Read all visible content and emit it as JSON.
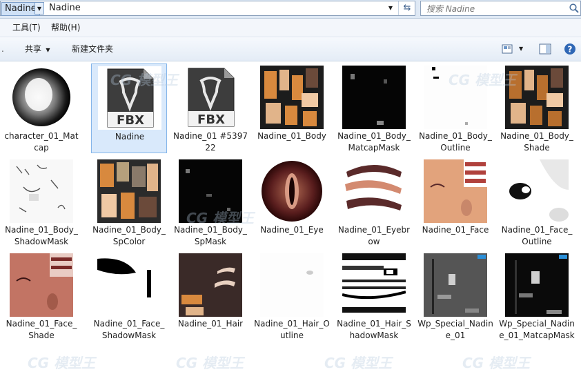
{
  "address_bar": {
    "crumbs": [
      "Nadine",
      "Nadine"
    ],
    "search_placeholder": "搜索 Nadine"
  },
  "menu": {
    "items": [
      "工具(T)",
      "帮助(H)"
    ]
  },
  "toolbar": {
    "share_label": "共享",
    "new_folder_label": "新建文件夹"
  },
  "files": [
    {
      "name": "character_01_Matcap",
      "kind": "matcap",
      "selected": false
    },
    {
      "name": "Nadine",
      "kind": "fbx",
      "selected": true
    },
    {
      "name": "Nadine_01 #539722",
      "kind": "fbx",
      "selected": false
    },
    {
      "name": "Nadine_01_Body",
      "kind": "body",
      "selected": false
    },
    {
      "name": "Nadine_01_Body_MatcapMask",
      "kind": "dark-mask",
      "selected": false
    },
    {
      "name": "Nadine_01_Body_Outline",
      "kind": "white-dots",
      "selected": false
    },
    {
      "name": "Nadine_01_Body_Shade",
      "kind": "body-dark",
      "selected": false
    },
    {
      "name": "Nadine_01_Body_ShadowMask",
      "kind": "white-sketch",
      "selected": false
    },
    {
      "name": "Nadine_01_Body_SpColor",
      "kind": "spcolor",
      "selected": false
    },
    {
      "name": "Nadine_01_Body_SpMask",
      "kind": "dark-spots",
      "selected": false
    },
    {
      "name": "Nadine_01_Eye",
      "kind": "eye",
      "selected": false
    },
    {
      "name": "Nadine_01_Eyebrow",
      "kind": "eyebrow",
      "selected": false
    },
    {
      "name": "Nadine_01_Face",
      "kind": "face",
      "selected": false
    },
    {
      "name": "Nadine_01_Face_Outline",
      "kind": "face-outline",
      "selected": false
    },
    {
      "name": "Nadine_01_Face_Shade",
      "kind": "face-shade",
      "selected": false
    },
    {
      "name": "Nadine_01_Face_ShadowMask",
      "kind": "shadowmask",
      "selected": false
    },
    {
      "name": "Nadine_01_Hair",
      "kind": "hair",
      "selected": false
    },
    {
      "name": "Nadine_01_Hair_Outline",
      "kind": "white-dot",
      "selected": false
    },
    {
      "name": "Nadine_01_Hair_ShadowMask",
      "kind": "hair-shadow",
      "selected": false
    },
    {
      "name": "Wp_Special_Nadine_01",
      "kind": "wp-gray",
      "selected": false
    },
    {
      "name": "Wp_Special_Nadine_01_MatcapMask",
      "kind": "wp-black",
      "selected": false
    }
  ],
  "fbx_label": "FBX",
  "watermark": [
    "模型王",
    "CG"
  ],
  "colors": {
    "selection": "#d9e9fb",
    "selection_border": "#85b6ea",
    "skin": "#e2a37c",
    "orange": "#d8893e"
  }
}
